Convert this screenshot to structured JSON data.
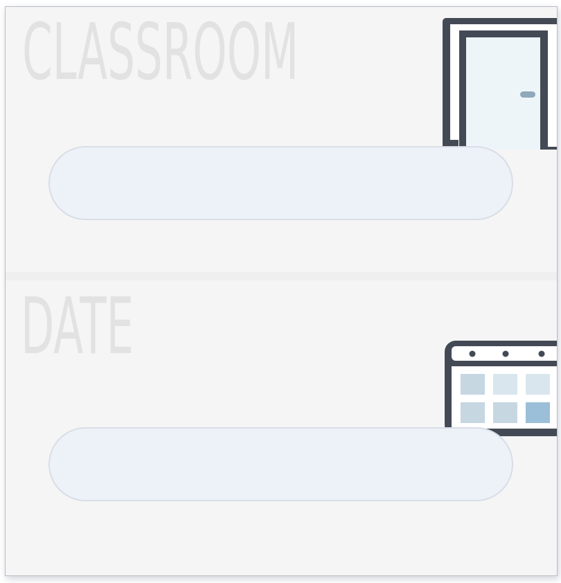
{
  "classroom": {
    "label": "CLASSROOM",
    "input_value": "",
    "icon": "door-icon"
  },
  "date": {
    "label": "DATE",
    "input_value": "",
    "icon": "calendar-icon"
  },
  "colors": {
    "background": "#f5f5f5",
    "label_text": "#e2e2e2",
    "input_fill": "#edf1f8",
    "icon_stroke": "#444a55",
    "accent_blue": "#9bbfd8"
  }
}
